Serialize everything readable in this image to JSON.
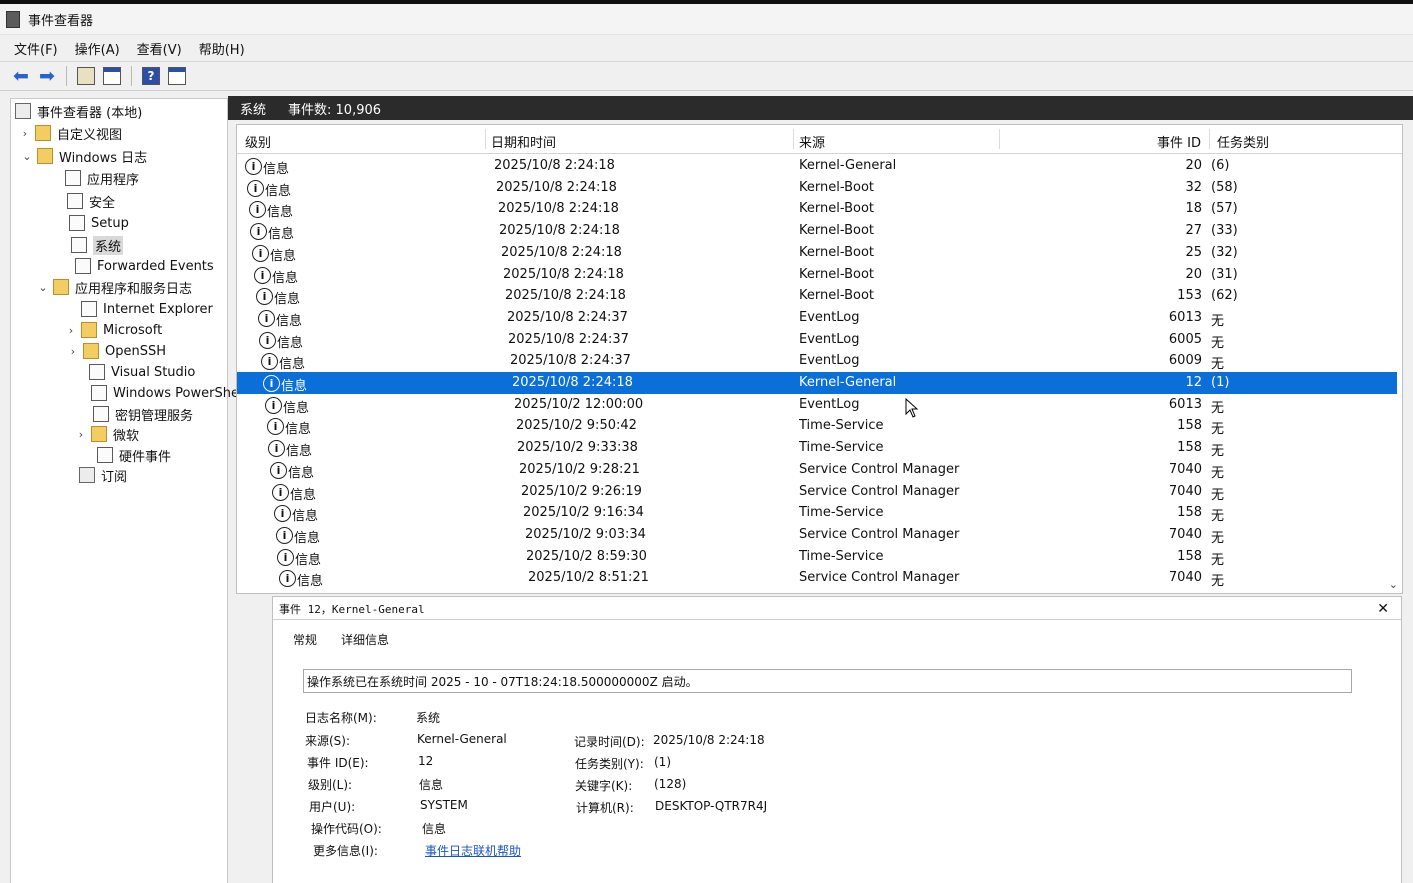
{
  "window": {
    "title": "事件查看器"
  },
  "menu": [
    "文件(F)",
    "操作(A)",
    "查看(V)",
    "帮助(H)"
  ],
  "toolbar": [
    "back-arrow-icon",
    "forward-arrow-icon",
    "up-folder-icon",
    "show-hide-tree-icon",
    "help-icon",
    "action-pane-icon"
  ],
  "tree": [
    {
      "label": "事件查看器 (本地)",
      "icon": "event-viewer-icon"
    },
    {
      "label": "自定义视图",
      "icon": "folder-icon"
    },
    {
      "label": "Windows 日志",
      "icon": "folder-icon"
    },
    {
      "label": "应用程序",
      "icon": "log-icon"
    },
    {
      "label": "安全",
      "icon": "log-icon"
    },
    {
      "label": "Setup",
      "icon": "log-icon"
    },
    {
      "label": "系统",
      "icon": "log-icon"
    },
    {
      "label": "Forwarded Events",
      "icon": "log-icon"
    },
    {
      "label": "应用程序和服务日志",
      "icon": "folder-icon"
    },
    {
      "label": "Internet Explorer",
      "icon": "log-icon"
    },
    {
      "label": "Microsoft",
      "icon": "folder-icon"
    },
    {
      "label": "OpenSSH",
      "icon": "folder-icon"
    },
    {
      "label": "Visual Studio",
      "icon": "log-icon"
    },
    {
      "label": "Windows PowerShell",
      "icon": "log-icon"
    },
    {
      "label": "密钥管理服务",
      "icon": "log-icon"
    },
    {
      "label": "微软",
      "icon": "folder-icon"
    },
    {
      "label": "硬件事件",
      "icon": "log-icon"
    },
    {
      "label": "订阅",
      "icon": "subscription-icon"
    }
  ],
  "header": {
    "log_name": "系统",
    "event_count": "事件数: 10,906"
  },
  "columns": {
    "level": "级别",
    "datetime": "日期和时间",
    "source": "来源",
    "event_id": "事件 ID",
    "task": "任务类别"
  },
  "rows": [
    {
      "level": "信息",
      "datetime": "2025/10/8 2:24:18",
      "source": "Kernel-General",
      "event_id": "20",
      "task": "(6)"
    },
    {
      "level": "信息",
      "datetime": "2025/10/8 2:24:18",
      "source": "Kernel-Boot",
      "event_id": "32",
      "task": "(58)"
    },
    {
      "level": "信息",
      "datetime": "2025/10/8 2:24:18",
      "source": "Kernel-Boot",
      "event_id": "18",
      "task": "(57)"
    },
    {
      "level": "信息",
      "datetime": "2025/10/8 2:24:18",
      "source": "Kernel-Boot",
      "event_id": "27",
      "task": "(33)"
    },
    {
      "level": "信息",
      "datetime": "2025/10/8 2:24:18",
      "source": "Kernel-Boot",
      "event_id": "25",
      "task": "(32)"
    },
    {
      "level": "信息",
      "datetime": "2025/10/8 2:24:18",
      "source": "Kernel-Boot",
      "event_id": "20",
      "task": "(31)"
    },
    {
      "level": "信息",
      "datetime": "2025/10/8 2:24:18",
      "source": "Kernel-Boot",
      "event_id": "153",
      "task": "(62)"
    },
    {
      "level": "信息",
      "datetime": "2025/10/8 2:24:37",
      "source": "EventLog",
      "event_id": "6013",
      "task": "无"
    },
    {
      "level": "信息",
      "datetime": "2025/10/8 2:24:37",
      "source": "EventLog",
      "event_id": "6005",
      "task": "无"
    },
    {
      "level": "信息",
      "datetime": "2025/10/8 2:24:37",
      "source": "EventLog",
      "event_id": "6009",
      "task": "无"
    },
    {
      "level": "信息",
      "datetime": "2025/10/8 2:24:18",
      "source": "Kernel-General",
      "event_id": "12",
      "task": "(1)"
    },
    {
      "level": "信息",
      "datetime": "2025/10/2 12:00:00",
      "source": "EventLog",
      "event_id": "6013",
      "task": "无"
    },
    {
      "level": "信息",
      "datetime": "2025/10/2 9:50:42",
      "source": "Time-Service",
      "event_id": "158",
      "task": "无"
    },
    {
      "level": "信息",
      "datetime": "2025/10/2 9:33:38",
      "source": "Time-Service",
      "event_id": "158",
      "task": "无"
    },
    {
      "level": "信息",
      "datetime": "2025/10/2 9:28:21",
      "source": "Service Control Manager",
      "event_id": "7040",
      "task": "无"
    },
    {
      "level": "信息",
      "datetime": "2025/10/2 9:26:19",
      "source": "Service Control Manager",
      "event_id": "7040",
      "task": "无"
    },
    {
      "level": "信息",
      "datetime": "2025/10/2 9:16:34",
      "source": "Time-Service",
      "event_id": "158",
      "task": "无"
    },
    {
      "level": "信息",
      "datetime": "2025/10/2 9:03:34",
      "source": "Service Control Manager",
      "event_id": "7040",
      "task": "无"
    },
    {
      "level": "信息",
      "datetime": "2025/10/2 8:59:30",
      "source": "Time-Service",
      "event_id": "158",
      "task": "无"
    },
    {
      "level": "信息",
      "datetime": "2025/10/2 8:51:21",
      "source": "Service Control Manager",
      "event_id": "7040",
      "task": "无"
    }
  ],
  "selected_row": 10,
  "detail": {
    "title": "事件 12，Kernel-General",
    "tabs": [
      "常规",
      "详细信息"
    ],
    "message": "操作系统已在系统时间   2025   -   10   -   07T18:24:18.500000000Z 启动。",
    "props_left": [
      {
        "label": "日志名称(M):",
        "value": "系统"
      },
      {
        "label": "来源(S):",
        "value": "Kernel-General"
      },
      {
        "label": "事件 ID(E):",
        "value": "12"
      },
      {
        "label": "级别(L):",
        "value": "信息"
      },
      {
        "label": "用户(U):",
        "value": "SYSTEM"
      },
      {
        "label": "操作代码(O):",
        "value": "信息"
      },
      {
        "label": "更多信息(I):",
        "value": "事件日志联机帮助"
      }
    ],
    "props_right": [
      {
        "label": "记录时间(D):",
        "value": "2025/10/8 2:24:18"
      },
      {
        "label": "任务类别(Y):",
        "value": "(1)"
      },
      {
        "label": "关键字(K):",
        "value": "(128)"
      },
      {
        "label": "计算机(R):",
        "value": "DESKTOP-QTR7R4J"
      }
    ]
  },
  "colors": {
    "selection": "#0a6fd8",
    "header_bar": "#2b2b2b",
    "link": "#1a56c2"
  }
}
